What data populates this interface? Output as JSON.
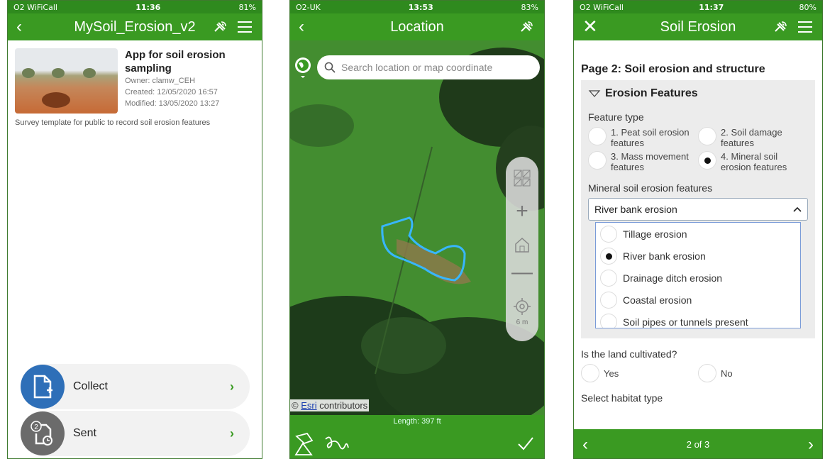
{
  "phone1": {
    "status": {
      "carrier": "O2 WiFiCall",
      "time": "11:36",
      "battery": "81%"
    },
    "header": {
      "title": "MySoil_Erosion_v2",
      "back_icon": "chevron-left-icon",
      "gps_icon": "satellite-icon",
      "menu_icon": "menu-icon"
    },
    "survey": {
      "title": "App for soil erosion sampling",
      "owner": "Owner: clamw_CEH",
      "created": "Created: 12/05/2020 16:57",
      "modified": "Modified: 13/05/2020 13:27",
      "description": "Survey template for public to record soil erosion features"
    },
    "actions": [
      {
        "label": "Collect",
        "icon": "new-form-icon",
        "color": "#2e6fb8"
      },
      {
        "label": "Sent",
        "icon": "sent-forms-icon",
        "badge": "2",
        "color": "#6b6b6b"
      }
    ]
  },
  "phone2": {
    "status": {
      "carrier": "O2-UK",
      "time": "13:53",
      "battery": "83%"
    },
    "header": {
      "title": "Location"
    },
    "search": {
      "placeholder": "Search location or map coordinate"
    },
    "scale": "6 m",
    "attribution": {
      "prefix": "©",
      "link": "Esri",
      "suffix": "contributors"
    },
    "length": "Length: 397 ft"
  },
  "phone3": {
    "status": {
      "carrier": "O2 WiFiCall",
      "time": "11:37",
      "battery": "80%"
    },
    "header": {
      "title": "Soil Erosion"
    },
    "page_title": "Page 2: Soil erosion and structure",
    "group_title": "Erosion Features",
    "feature_type": {
      "label": "Feature type",
      "options": [
        {
          "label": "1. Peat soil erosion features",
          "selected": false
        },
        {
          "label": "2. Soil damage features",
          "selected": false
        },
        {
          "label": "3. Mass movement features",
          "selected": false
        },
        {
          "label": "4. Mineral soil erosion features",
          "selected": true
        }
      ]
    },
    "mineral": {
      "label": "Mineral soil erosion features",
      "selected": "River bank erosion",
      "options": [
        {
          "label": "Tillage erosion",
          "selected": false
        },
        {
          "label": "River bank erosion",
          "selected": true
        },
        {
          "label": "Drainage ditch erosion",
          "selected": false
        },
        {
          "label": "Coastal erosion",
          "selected": false
        },
        {
          "label": "Soil pipes or tunnels present",
          "selected": false
        }
      ]
    },
    "cultivated": {
      "label": "Is the land cultivated?",
      "yes": "Yes",
      "no": "No"
    },
    "habitat": {
      "label": "Select habitat type"
    },
    "nav": {
      "page": "2 of 3"
    }
  }
}
